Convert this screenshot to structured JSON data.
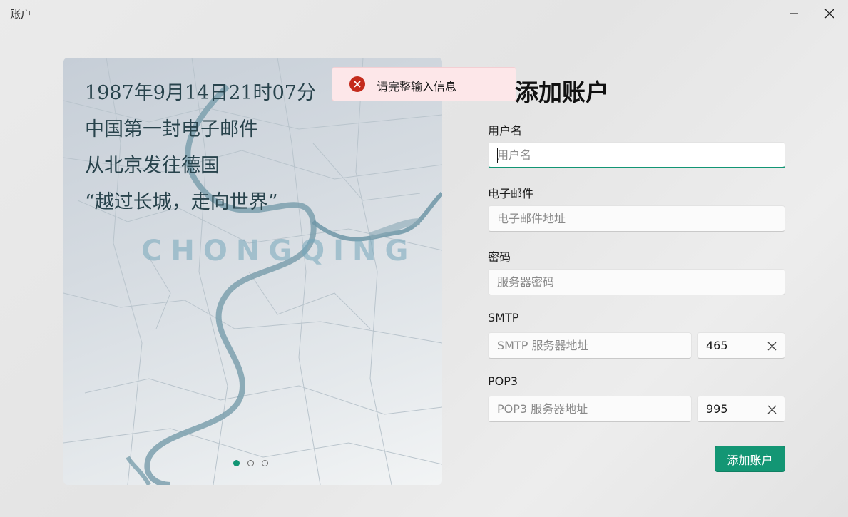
{
  "window": {
    "title": "账户"
  },
  "banner": {
    "quote_lines": [
      "1987年9月14日21时07分",
      "中国第一封电子邮件",
      "从北京发往德国",
      "“越过长城，走向世界”"
    ],
    "city": "CHONGQING",
    "carousel": {
      "count": 3,
      "active": 1
    }
  },
  "toast": {
    "type": "error",
    "icon": "error-circle-icon",
    "message": "请完整输入信息"
  },
  "form": {
    "title": "添加账户",
    "username": {
      "label": "用户名",
      "placeholder": "用户名",
      "value": ""
    },
    "email": {
      "label": "电子邮件",
      "placeholder": "电子邮件地址",
      "value": ""
    },
    "password": {
      "label": "密码",
      "placeholder": "服务器密码",
      "value": ""
    },
    "smtp": {
      "label": "SMTP",
      "placeholder": "SMTP 服务器地址",
      "value": "",
      "port": "465"
    },
    "pop3": {
      "label": "POP3",
      "placeholder": "POP3 服务器地址",
      "value": "",
      "port": "995"
    },
    "submit_label": "添加账户"
  },
  "colors": {
    "accent": "#129574",
    "error": "#c42b1c",
    "toast_bg": "#fde7e9"
  }
}
